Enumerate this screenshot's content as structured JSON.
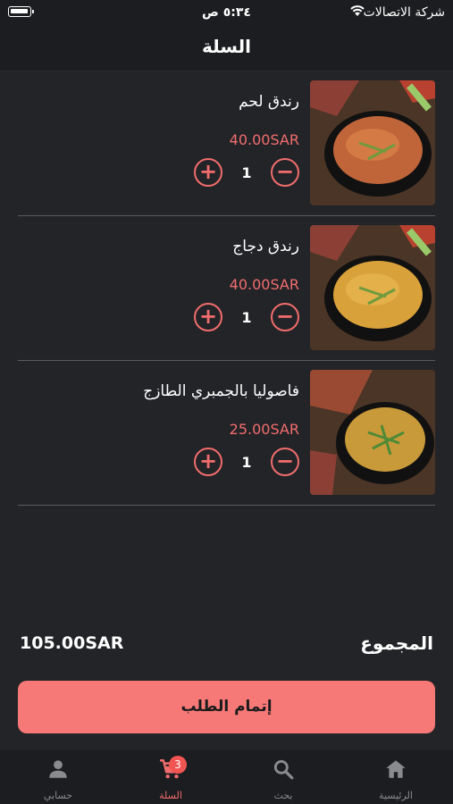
{
  "status_bar": {
    "time": "٥:٣٤ ص",
    "carrier": "شركة الاتصالات"
  },
  "header": {
    "title": "السلة"
  },
  "cart": {
    "items": [
      {
        "name": "رندق لحم",
        "price": "40.00SAR",
        "qty": "1"
      },
      {
        "name": "رندق دجاج",
        "price": "40.00SAR",
        "qty": "1"
      },
      {
        "name": "فاصوليا بالجمبري الطازج",
        "price": "25.00SAR",
        "qty": "1"
      }
    ]
  },
  "summary": {
    "total_label": "المجموع",
    "total_value": "105.00SAR"
  },
  "checkout_label": "إتمام الطلب",
  "tabs": [
    {
      "label": "الرئيسية",
      "icon": "home-icon"
    },
    {
      "label": "بحث",
      "icon": "search-icon"
    },
    {
      "label": "السلة",
      "icon": "cart-icon",
      "badge": "3",
      "active": true
    },
    {
      "label": "حسابي",
      "icon": "person-icon"
    }
  ],
  "colors": {
    "accent": "#f16d6d",
    "button": "#f67877",
    "background": "#232428",
    "bar": "#1c1d20"
  }
}
